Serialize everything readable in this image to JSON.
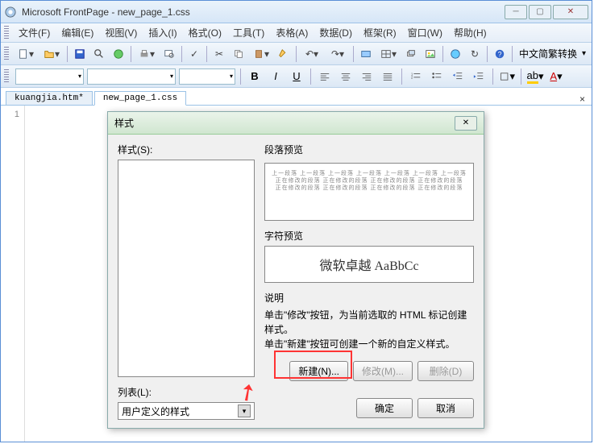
{
  "window": {
    "title": "Microsoft FrontPage - new_page_1.css"
  },
  "menubar": {
    "items": [
      {
        "label": "文件(F)"
      },
      {
        "label": "编辑(E)"
      },
      {
        "label": "视图(V)"
      },
      {
        "label": "插入(I)"
      },
      {
        "label": "格式(O)"
      },
      {
        "label": "工具(T)"
      },
      {
        "label": "表格(A)"
      },
      {
        "label": "数据(D)"
      },
      {
        "label": "框架(R)"
      },
      {
        "label": "窗口(W)"
      },
      {
        "label": "帮助(H)"
      }
    ]
  },
  "toolbar": {
    "lang_convert": "中文简繁转换"
  },
  "tabs": {
    "items": [
      {
        "label": "kuangjia.htm*",
        "active": false
      },
      {
        "label": "new_page_1.css",
        "active": true
      }
    ]
  },
  "editor": {
    "line": "1"
  },
  "dialog": {
    "title": "样式",
    "styles_label": "样式(S):",
    "list_label": "列表(L):",
    "list_value": "用户定义的样式",
    "para_preview_label": "段落预览",
    "para_preview_text": "上一段落 上一段落 上一段落 上一段落 上一段落 上一段落 上一段落\n正在修改的段落 正在修改的段落 正在修改的段落 正在修改的段落\n正在修改的段落 正在修改的段落 正在修改的段落 正在修改的段落",
    "char_preview_label": "字符预览",
    "char_preview_text": "微软卓越 AaBbCc",
    "desc_label": "说明",
    "desc_text1": "单击\"修改\"按钮，为当前选取的 HTML 标记创建样式。",
    "desc_text2": "单击\"新建\"按钮可创建一个新的自定义样式。",
    "btn_new": "新建(N)...",
    "btn_modify": "修改(M)...",
    "btn_delete": "删除(D)",
    "btn_ok": "确定",
    "btn_cancel": "取消"
  }
}
